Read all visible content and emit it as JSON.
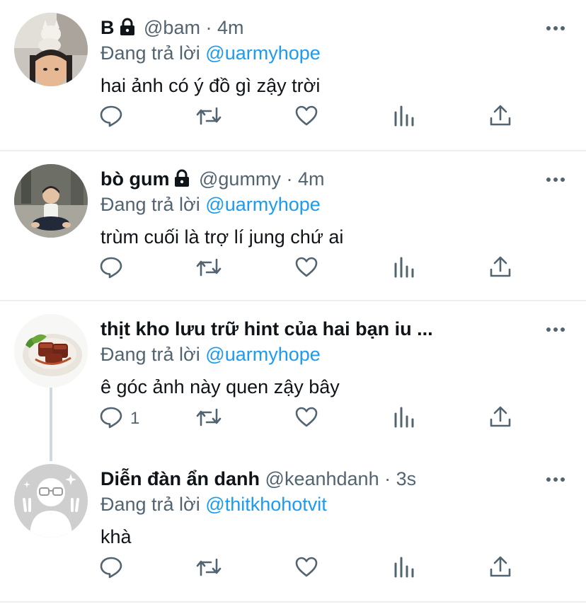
{
  "tweets": [
    {
      "name": "B",
      "locked": true,
      "handle": "@bam",
      "time": "4m",
      "reply_prefix": "Đang trả lời",
      "reply_to": "@uarmyhope",
      "text": "hai ảnh có ý đồ gì zậy trời",
      "reply_count": "",
      "avatar_icon": "photo-cat-person"
    },
    {
      "name": "bò gum",
      "locked": true,
      "handle": "@gummy",
      "time": "4m",
      "reply_prefix": "Đang trả lời",
      "reply_to": "@uarmyhope",
      "text": "trùm cuối là trợ lí jung chứ ai",
      "reply_count": "",
      "avatar_icon": "photo-child-sitting"
    },
    {
      "name": "thịt kho lưu trữ hint của hai bạn iu ...",
      "locked": false,
      "handle": "",
      "time": "",
      "reply_prefix": "Đang trả lời",
      "reply_to": "@uarmyhope",
      "text": "ê góc ảnh này quen zậy bây",
      "reply_count": "1",
      "avatar_icon": "braised-pork-dish"
    },
    {
      "name": "Diễn đàn ẩn danh",
      "locked": false,
      "handle": "@keanhdanh",
      "time": "3s",
      "reply_prefix": "Đang trả lời",
      "reply_to": "@thitkhohotvit",
      "text": "khà",
      "reply_count": "",
      "avatar_icon": "anonymous-glasses-face"
    }
  ],
  "meta_separator": "·",
  "action_icons": [
    "reply-icon",
    "retweet-icon",
    "like-icon",
    "analytics-icon",
    "share-icon"
  ],
  "colors": {
    "link": "#1d9bf0",
    "secondary": "#536471",
    "primary": "#0f1419",
    "divider": "#eceff1"
  }
}
